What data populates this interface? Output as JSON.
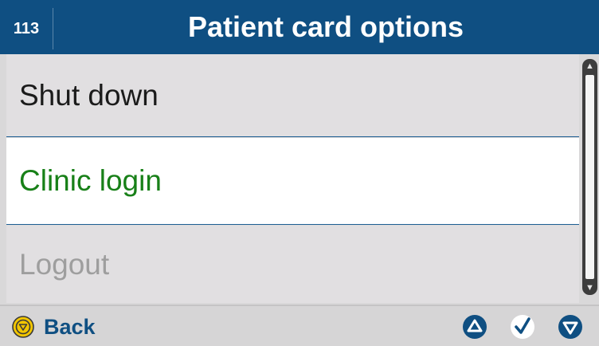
{
  "header": {
    "screen_number": "113",
    "title": "Patient card options"
  },
  "menu": {
    "items": [
      {
        "label": "Shut down",
        "state": "normal"
      },
      {
        "label": "Clinic login",
        "state": "selected"
      },
      {
        "label": "Logout",
        "state": "disabled"
      }
    ]
  },
  "footer": {
    "back_label": "Back",
    "back_icon": "yellow-circle-triangle-down-icon",
    "nav_icons": [
      "up-arrow-icon",
      "checkmark-icon",
      "down-arrow-icon"
    ]
  },
  "colors": {
    "header_bg": "#0f4f82",
    "selected_text": "#188018",
    "disabled_text": "#9e9e9e",
    "accent_blue": "#0f4f82",
    "back_yellow": "#f2c600"
  }
}
